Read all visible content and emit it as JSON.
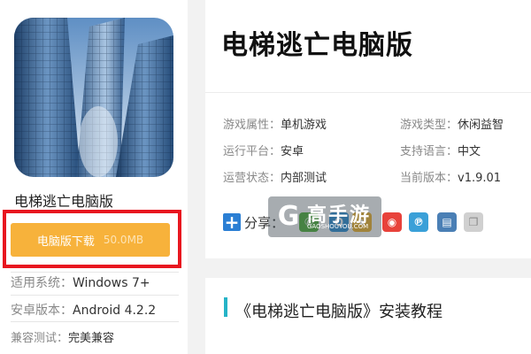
{
  "app": {
    "name": "电梯逃亡电脑版",
    "title": "电梯逃亡电脑版"
  },
  "download": {
    "label": "电脑版下载",
    "size": "50.0MB"
  },
  "specs": [
    {
      "key": "适用系统：",
      "value": "Windows 7+"
    },
    {
      "key": "安卓版本：",
      "value": "Android 4.2.2"
    },
    {
      "key": "兼容测试：",
      "value": "完美兼容"
    }
  ],
  "info": {
    "attr_key": "游戏属性：",
    "attr_val": "单机游戏",
    "type_key": "游戏类型：",
    "type_val": "休闲益智",
    "platform_key": "运行平台：",
    "platform_val": "安卓",
    "lang_key": "支持语言：",
    "lang_val": "中文",
    "status_key": "运营状态：",
    "status_val": "内部测试",
    "version_key": "当前版本：",
    "version_val": "v1.9.01"
  },
  "share": {
    "label": "分享："
  },
  "watermark": {
    "logo_char": "G",
    "text": "高手游",
    "url": "GAOSHOUYOU.COM"
  },
  "section": {
    "title": "《电梯逃亡电脑版》安装教程"
  },
  "colors": {
    "download_button": "#f7b23b",
    "highlight_border": "#e8161f",
    "section_accent": "#25b3c7",
    "share_plus": "#2b7fd4"
  },
  "icons": {
    "share_icons": [
      "weixin-icon",
      "qq-icon",
      "qzone-icon",
      "weibo-icon",
      "tencent-weibo-icon",
      "print-icon",
      "copy-icon"
    ]
  }
}
